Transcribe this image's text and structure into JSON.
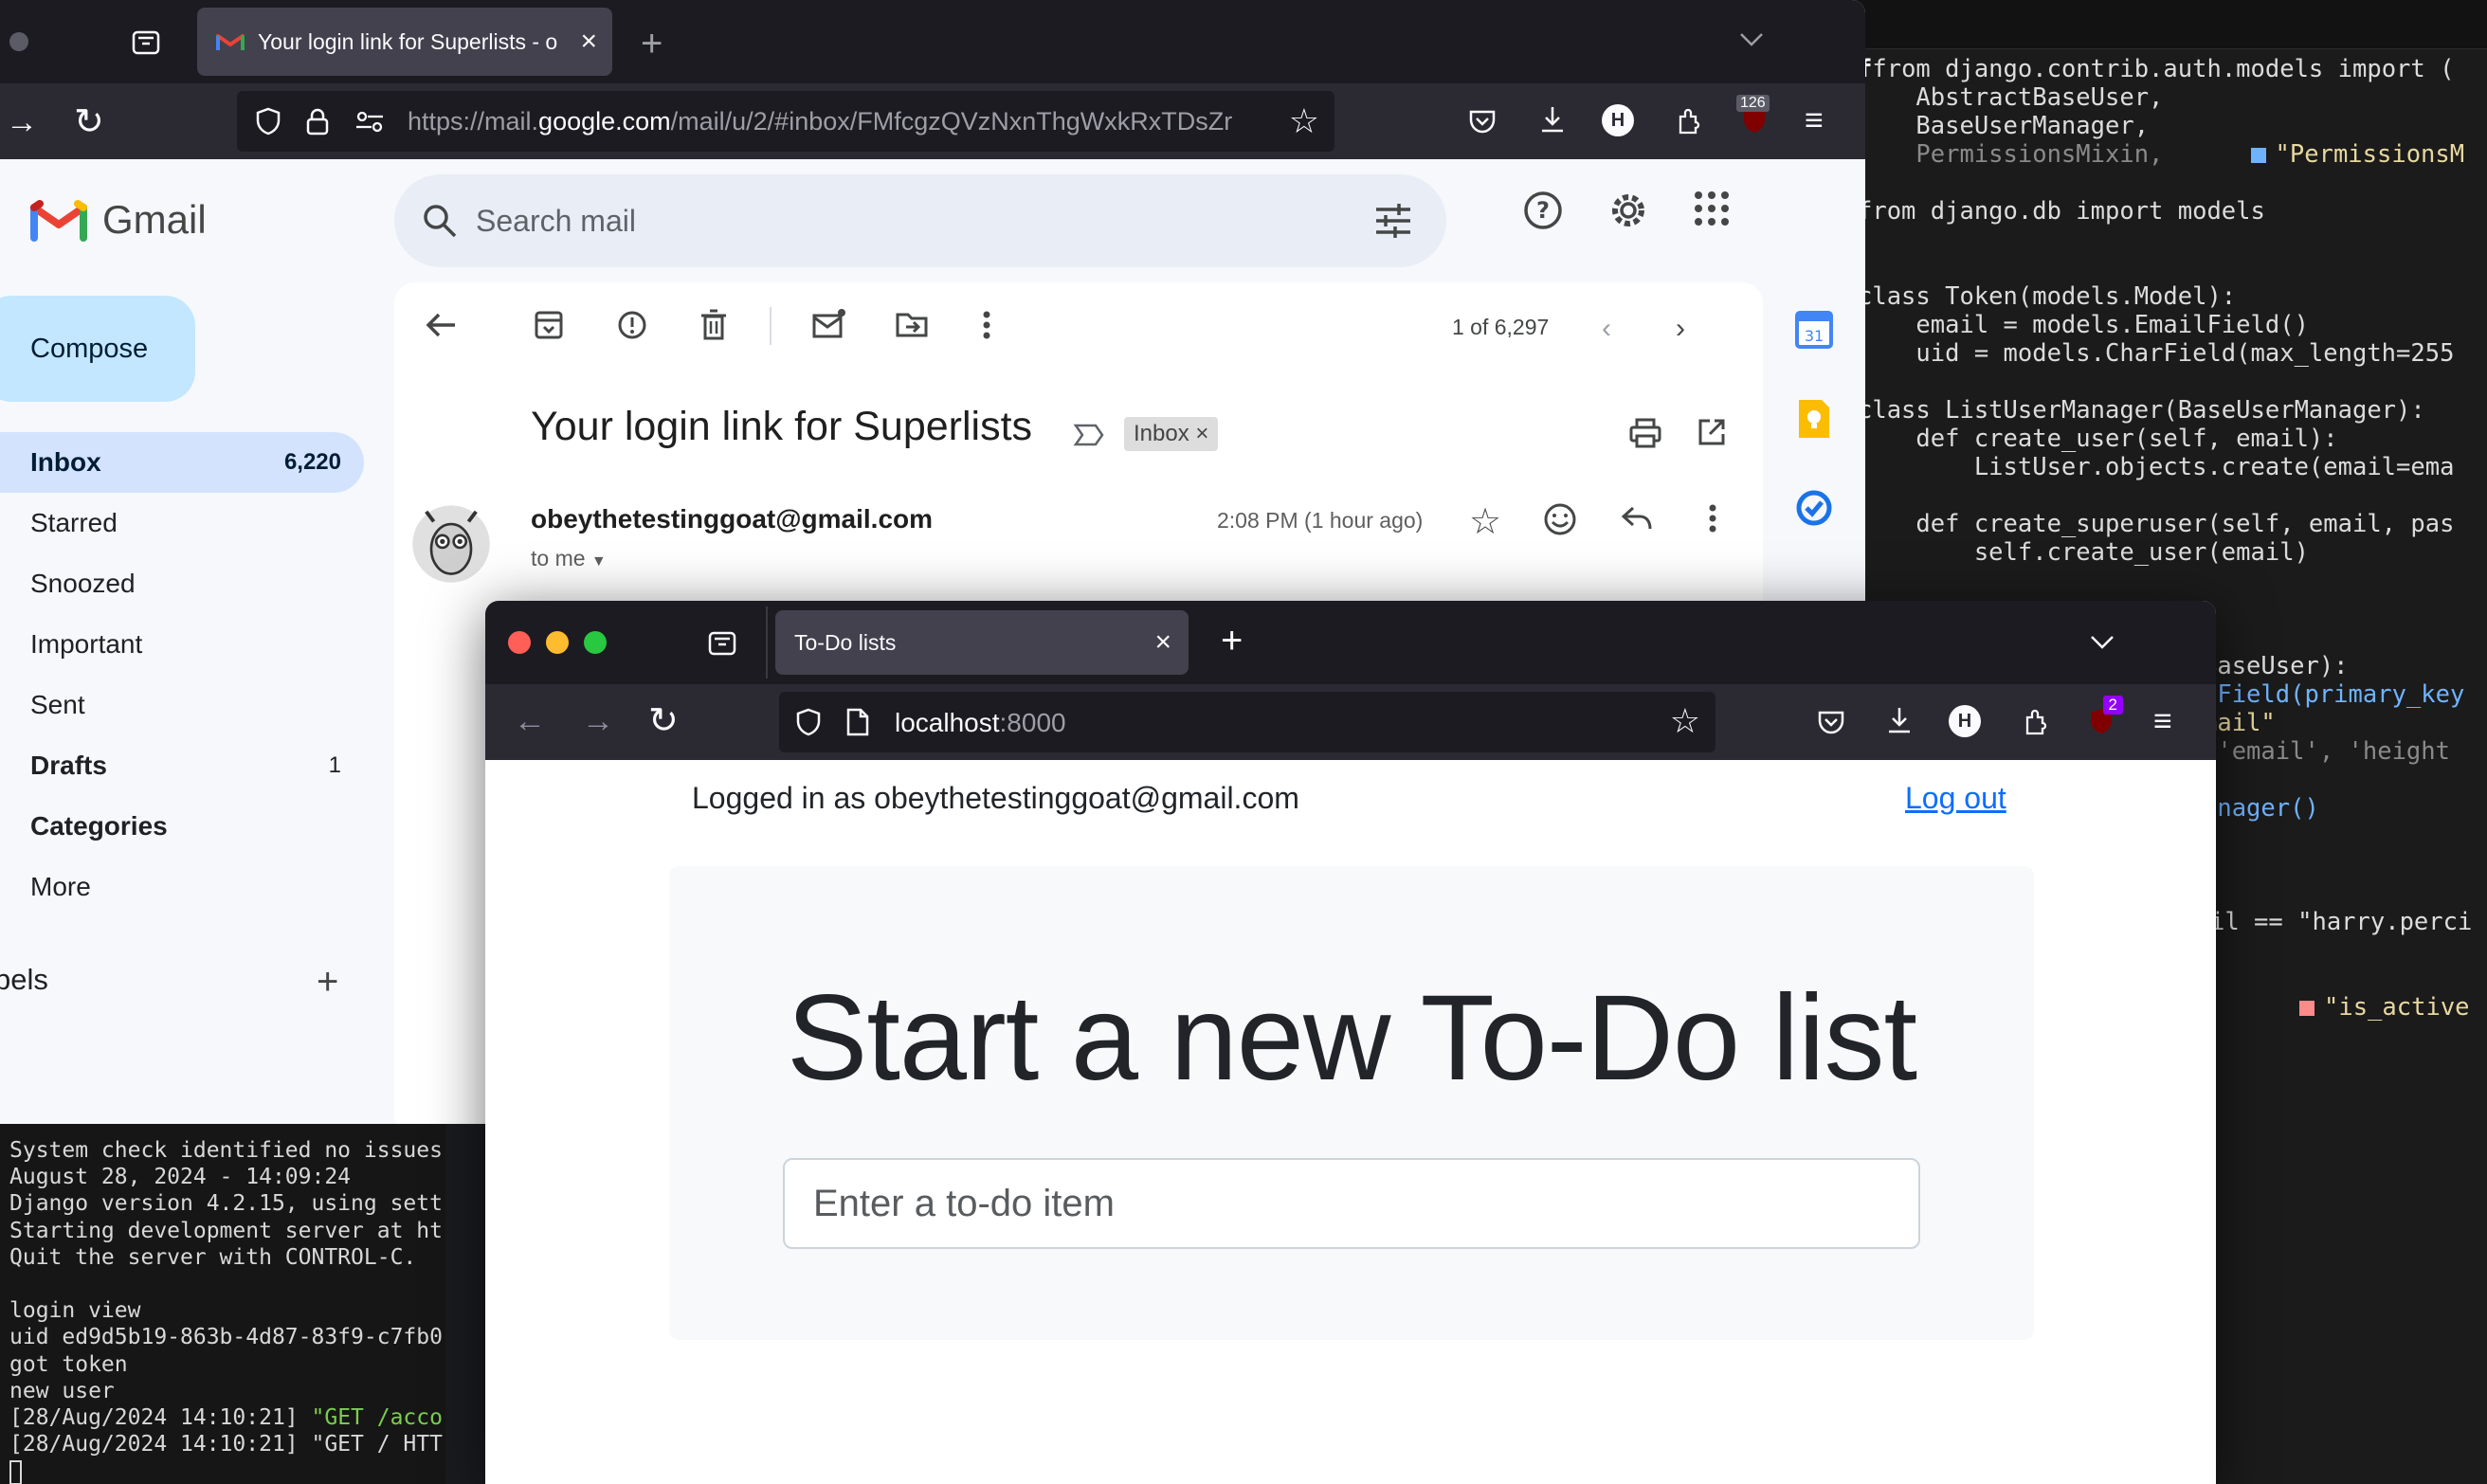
{
  "editor": {
    "lines": [
      "from django.contrib.auth.models import (",
      "    AbstractBaseUser,",
      "    BaseUserManager,",
      "    PermissionsMixin,",
      "from django.db import models",
      "class Token(models.Model):",
      "    email = models.EmailField()",
      "    uid = models.CharField(max_length=255",
      "class ListUserManager(BaseUserManager):",
      "    def create_user(self, email):",
      "        ListUser.objects.create(email=ema",
      "    def create_superuser(self, email, pas",
      "        self.create_user(email)",
      "BaseUser):",
      "lField(primary_key",
      "mail\"",
      "['email', 'height",
      "anager()",
      "il == \"harry.perci",
      "\"is_active"
    ],
    "hint_permissions": "\"PermissionsM"
  },
  "terminal": {
    "lines": [
      "System check identified no issues",
      "August 28, 2024 - 14:09:24",
      "Django version 4.2.15, using sett",
      "Starting development server at ht",
      "Quit the server with CONTROL-C.",
      "",
      "login view",
      "uid ed9d5b19-863b-4d87-83f9-c7fb0",
      "got token",
      "new user"
    ],
    "log1_prefix": "[28/Aug/2024 14:10:21] ",
    "log1_req": "\"GET /acco",
    "log2": "[28/Aug/2024 14:10:21] \"GET / HTT"
  },
  "gmail_window": {
    "tab_title": "Your login link for Superlists - o",
    "url_pre": "https://mail.",
    "url_host": "google.com",
    "url_post": "/mail/u/2/#inbox/FMfcgzQVzNxnThgWxkRxTDsZr",
    "badge_count": "126",
    "brand": "Gmail",
    "search_placeholder": "Search mail",
    "compose_label": "Compose",
    "nav": [
      {
        "label": "Inbox",
        "count": "6,220"
      },
      {
        "label": "Starred",
        "count": ""
      },
      {
        "label": "Snoozed",
        "count": ""
      },
      {
        "label": "Important",
        "count": ""
      },
      {
        "label": "Sent",
        "count": ""
      },
      {
        "label": "Drafts",
        "count": "1"
      },
      {
        "label": "Categories",
        "count": ""
      },
      {
        "label": "More",
        "count": ""
      }
    ],
    "labels_heading": "bels",
    "pager_text": "1 of 6,297",
    "subject": "Your login link for Superlists",
    "inbox_chip": "Inbox",
    "sender": "obeythetestinggoat@gmail.com",
    "to_me": "to me",
    "time": "2:08 PM (1 hour ago)"
  },
  "todo_window": {
    "tab_title": "To-Do lists",
    "url_host": "localhost",
    "url_port": ":8000",
    "badge_count": "2",
    "logged_in_text": "Logged in as obeythetestinggoat@gmail.com",
    "logout_label": "Log out",
    "heading": "Start a new To-Do list",
    "input_placeholder": "Enter a to-do item"
  },
  "colors": {
    "gmail_red": "#ea4335",
    "gmail_blue": "#4285f4",
    "gmail_yellow": "#fbbc04",
    "gmail_green": "#34a853",
    "link_blue": "#0d6efd"
  }
}
